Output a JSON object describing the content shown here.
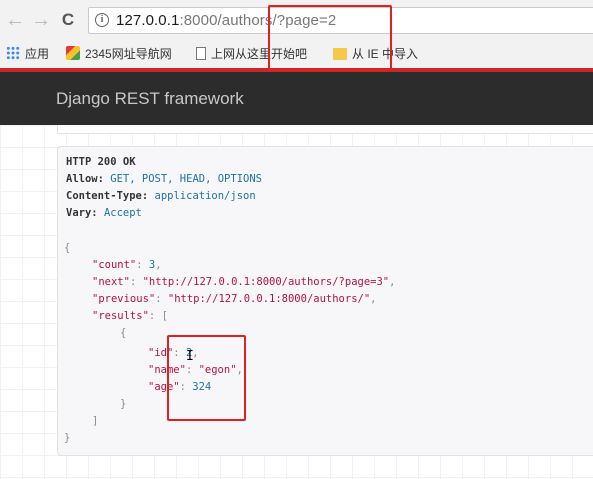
{
  "browser": {
    "back_icon": "←",
    "forward_icon": "→",
    "reload_icon": "C",
    "info_icon": "i",
    "url_host": "127.0.0.1",
    "url_rest": ":8000/authors/?page=2"
  },
  "bookmarks": [
    {
      "label": "应用",
      "icon": "apps-icon"
    },
    {
      "label": "2345网址导航网",
      "icon": "app-2345-icon"
    },
    {
      "label": "上网从这里开始吧",
      "icon": "page-icon"
    },
    {
      "label": "从 IE 中导入",
      "icon": "folder-icon"
    }
  ],
  "navbar": {
    "brand": "Django REST framework"
  },
  "response": {
    "status_line": "HTTP 200 OK",
    "headers": [
      {
        "name": "Allow:",
        "value": "GET, POST, HEAD, OPTIONS"
      },
      {
        "name": "Content-Type:",
        "value": "application/json"
      },
      {
        "name": "Vary:",
        "value": "Accept"
      }
    ],
    "body": {
      "open_brace": "{",
      "count_key": "\"count\"",
      "count_value": "3",
      "next_key": "\"next\"",
      "next_value": "\"http://127.0.0.1:8000/authors/?page=3\"",
      "previous_key": "\"previous\"",
      "previous_value": "\"http://127.0.0.1:8000/authors/\"",
      "results_key": "\"results\"",
      "open_bracket": "[",
      "item_open": "{",
      "id_key": "\"id\"",
      "id_value": "2",
      "name_key": "\"name\"",
      "name_value": "\"egon\"",
      "age_key": "\"age\"",
      "age_value": "324",
      "item_close": "}",
      "close_bracket": "]",
      "close_brace": "}"
    }
  },
  "colors": {
    "annotation": "#e12020",
    "navbar": "#2c2c2c",
    "accent_strip": "#c62828"
  }
}
